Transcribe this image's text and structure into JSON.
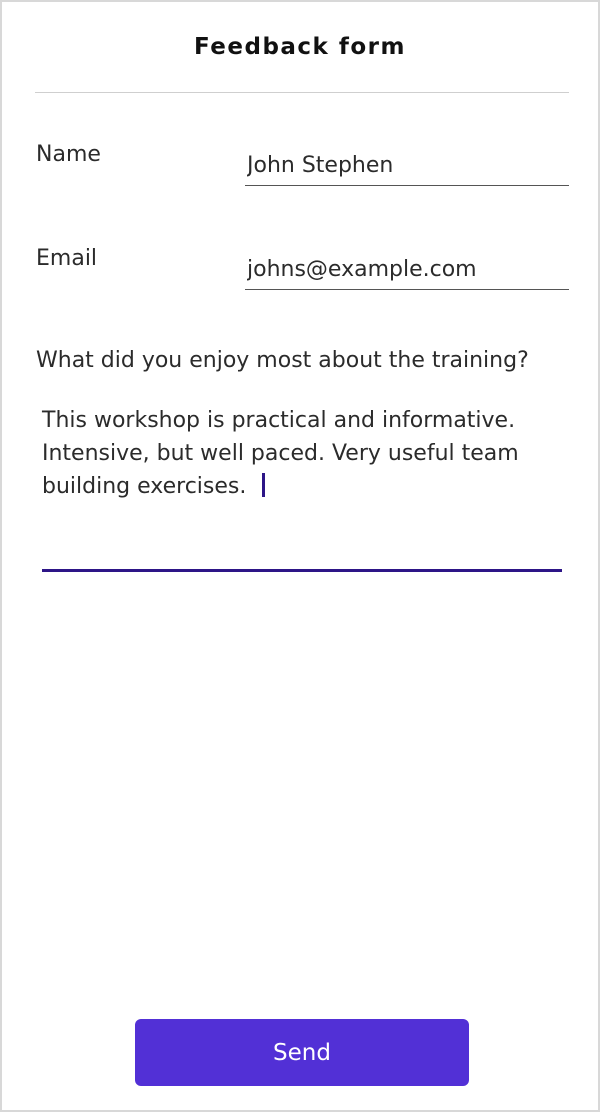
{
  "form": {
    "title": "Feedback form",
    "name": {
      "label": "Name",
      "value": "John Stephen"
    },
    "email": {
      "label": "Email",
      "value": "johns@example.com"
    },
    "question": "What did you enjoy most about the training?",
    "answer": "This workshop is practical and informative. Intensive, but well paced. Very useful team building exercises.",
    "send_label": "Send"
  },
  "colors": {
    "accent": "#5230d6",
    "focus_underline": "#2d1587",
    "divider": "#cfcfcf"
  }
}
